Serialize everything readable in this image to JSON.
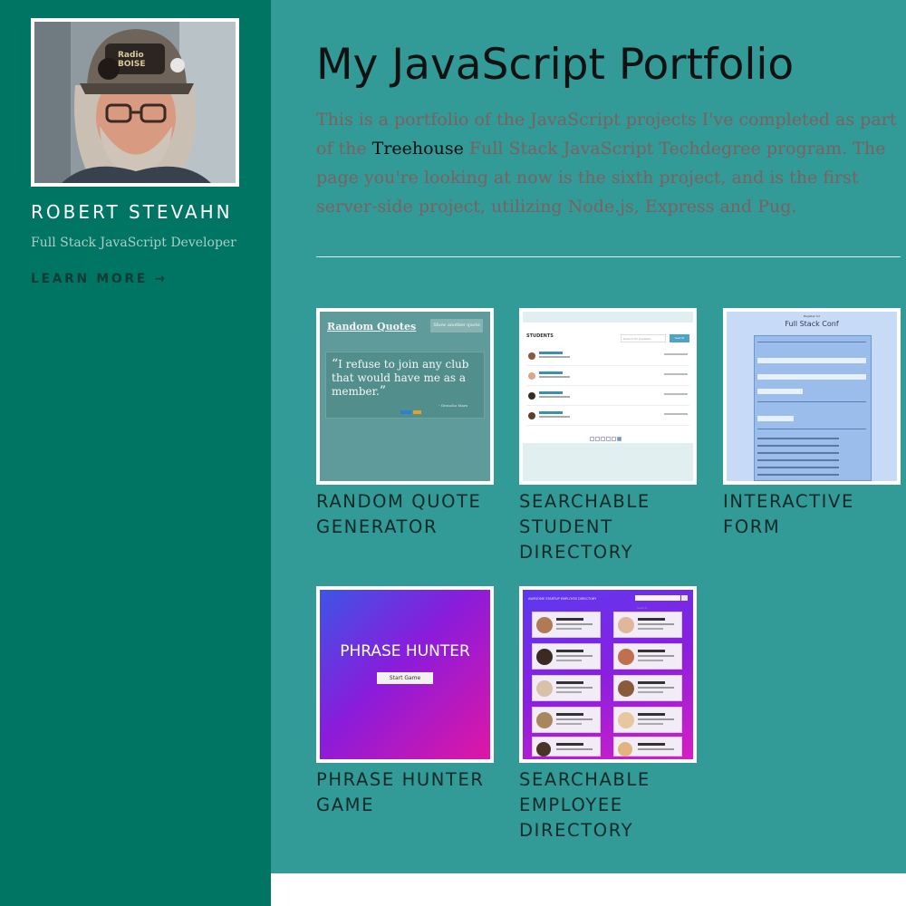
{
  "sidebar": {
    "name": "ROBERT STEVAHN",
    "role": "Full Stack JavaScript Developer",
    "learn_more": "LEARN MORE →",
    "avatar_cap_text": "Radio BOISE"
  },
  "main": {
    "title": "My JavaScript Portfolio",
    "intro_before": "This is a portfolio of the JavaScript projects I've completed as part of the ",
    "intro_link": "Treehouse",
    "intro_after": " Full Stack JavaScript Techdegree program. The page you're looking at now is the sixth project, and is the first server-side project, utilizing Node.js, Express and Pug."
  },
  "projects": [
    {
      "label": "RANDOM QUOTE GENERATOR",
      "thumb": {
        "title": "Random Quotes",
        "button": "Show another quote",
        "quote": "I refuse to join any club that would have me as a member.",
        "source": "- Groucho Marx"
      }
    },
    {
      "label": "SEARCHABLE STUDENT DIRECTORY",
      "thumb": {
        "heading": "STUDENTS",
        "search_placeholder": "Search for students...",
        "search_button": "Search"
      }
    },
    {
      "label": "INTERACTIVE FORM",
      "thumb": {
        "subtitle": "Register for",
        "title": "Full Stack Conf"
      }
    },
    {
      "label": "PHRASE HUNTER GAME",
      "thumb": {
        "title": "PHRASE HUNTER",
        "button": "Start Game"
      }
    },
    {
      "label": "SEARCHABLE EMPLOYEE DIRECTORY",
      "thumb": {
        "heading": "AWESOME STARTUP EMPLOYEE DIRECTORY",
        "search_placeholder": "Search..."
      }
    }
  ],
  "colors": {
    "sidebar_bg": "#007563",
    "main_bg": "#329a97",
    "intro_text": "#7c6161"
  }
}
